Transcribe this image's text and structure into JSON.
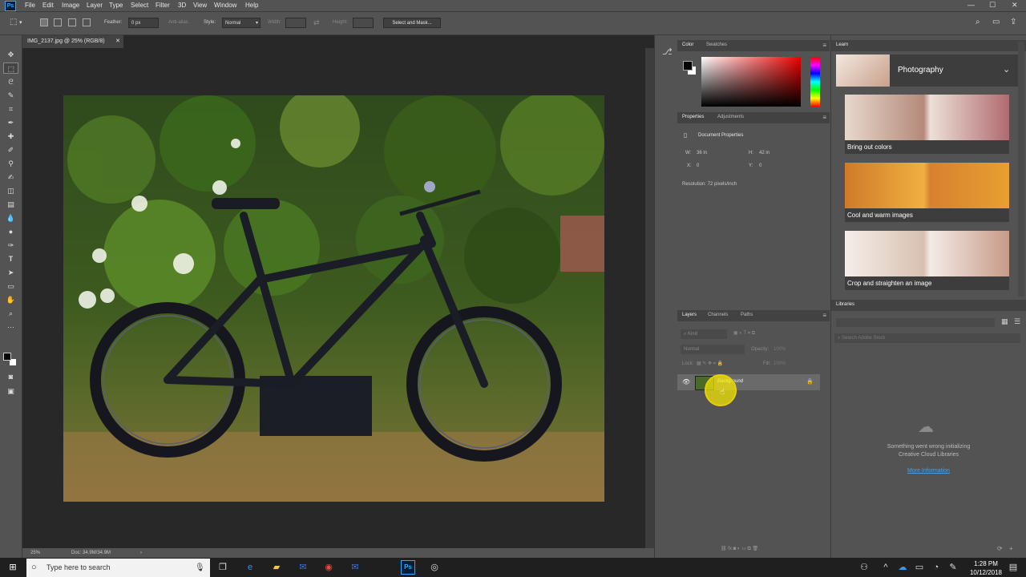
{
  "app": {
    "logo": "Ps"
  },
  "menu": [
    "File",
    "Edit",
    "Image",
    "Layer",
    "Type",
    "Select",
    "Filter",
    "3D",
    "View",
    "Window",
    "Help"
  ],
  "options": {
    "feather_label": "Feather:",
    "feather_value": "0 px",
    "antialias_label": "Anti-alias",
    "style_label": "Style:",
    "style_value": "Normal",
    "width_label": "Width:",
    "height_label": "Height:",
    "select_mask": "Select and Mask..."
  },
  "document": {
    "tab_title": "IMG_2137.jpg @ 25% (RGB/8)",
    "zoom": "25%",
    "doc_info": "Doc: 34.9M/34.9M"
  },
  "color_panel": {
    "tabs": [
      "Color",
      "Swatches"
    ]
  },
  "properties_panel": {
    "tabs": [
      "Properties",
      "Adjustments"
    ],
    "heading": "Document Properties",
    "w_label": "W:",
    "w_value": "36 in",
    "h_label": "H:",
    "h_value": "42 in",
    "x_label": "X:",
    "x_value": "0",
    "y_label": "Y:",
    "y_value": "0",
    "resolution": "Resolution: 72 pixels/inch"
  },
  "layers_panel": {
    "tabs": [
      "Layers",
      "Channels",
      "Paths"
    ],
    "kind": "Kind",
    "blend": "Normal",
    "opacity_label": "Opacity:",
    "opacity_value": "100%",
    "lock_label": "Lock:",
    "fill_label": "Fill:",
    "fill_value": "100%",
    "layer_name": "Background"
  },
  "learn_panel": {
    "tab": "Learn",
    "topic": "Photography",
    "cards": [
      "Bring out colors",
      "Cool and warm images",
      "Crop and straighten an image"
    ]
  },
  "libraries_panel": {
    "tab": "Libraries",
    "search_placeholder": "Search Adobe Stock",
    "error_line1": "Something went wrong initializing",
    "error_line2": "Creative Cloud Libraries",
    "more_info": "More Information"
  },
  "taskbar": {
    "search_placeholder": "Type here to search",
    "time": "1:28 PM",
    "date": "10/12/2018"
  },
  "colors": {
    "accent_blue": "#31a8ff",
    "link_blue": "#4aa0ea",
    "fg_swatch": "#000000",
    "bg_swatch": "#ffffff"
  }
}
